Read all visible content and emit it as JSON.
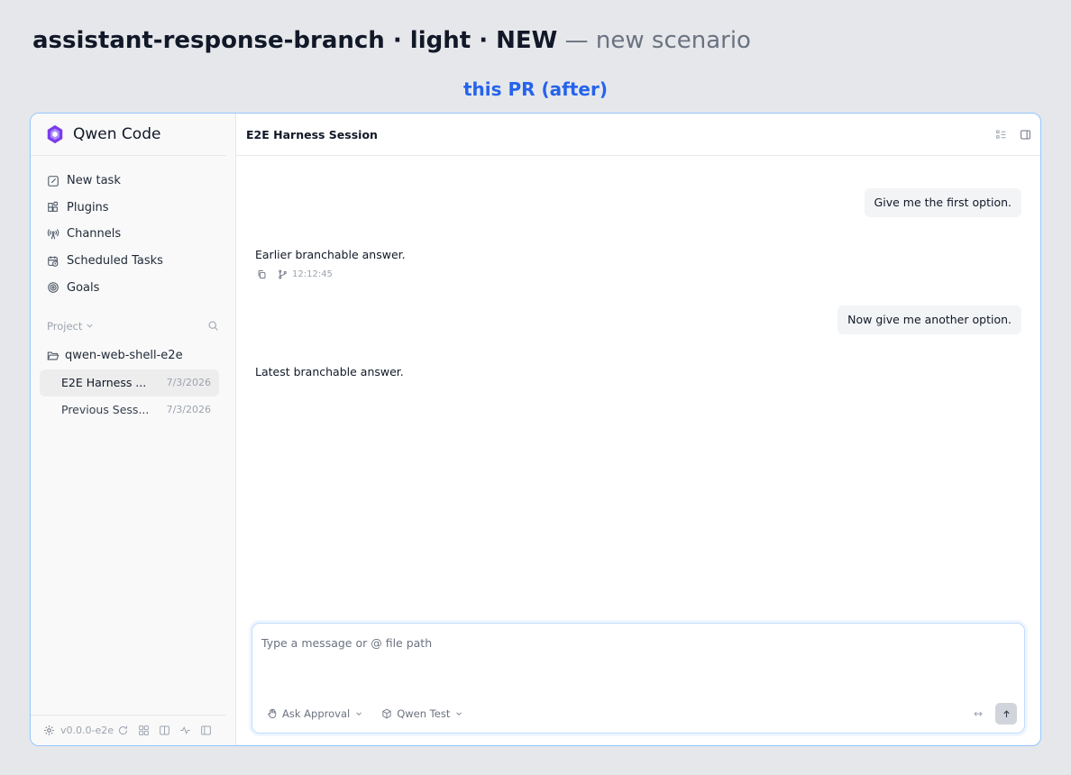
{
  "heading": {
    "scenario": "assistant-response-branch · light · NEW",
    "suffix": "— new scenario"
  },
  "variant_label": "this PR (after)",
  "app": {
    "name": "Qwen Code",
    "version": "v0.0.0-e2e"
  },
  "nav": {
    "new_task": "New task",
    "plugins": "Plugins",
    "channels": "Channels",
    "scheduled_tasks": "Scheduled Tasks",
    "goals": "Goals"
  },
  "project": {
    "label": "Project",
    "folder": "qwen-web-shell-e2e",
    "sessions": [
      {
        "title": "E2E Harness ...",
        "date": "7/3/2026"
      },
      {
        "title": "Previous Sess...",
        "date": "7/3/2026"
      }
    ]
  },
  "session": {
    "title": "E2E Harness Session"
  },
  "messages": {
    "user_1": "Give me the first option.",
    "assistant_1": "Earlier branchable answer.",
    "assistant_1_time": "12:12:45",
    "user_2": "Now give me another option.",
    "assistant_2": "Latest branchable answer."
  },
  "composer": {
    "placeholder": "Type a message or @ file path",
    "approval": "Ask Approval",
    "model": "Qwen Test",
    "expand": "↔"
  },
  "colors": {
    "accent": "#2563eb",
    "frame_border": "#93c5fd",
    "logo": "#7c3aed"
  }
}
